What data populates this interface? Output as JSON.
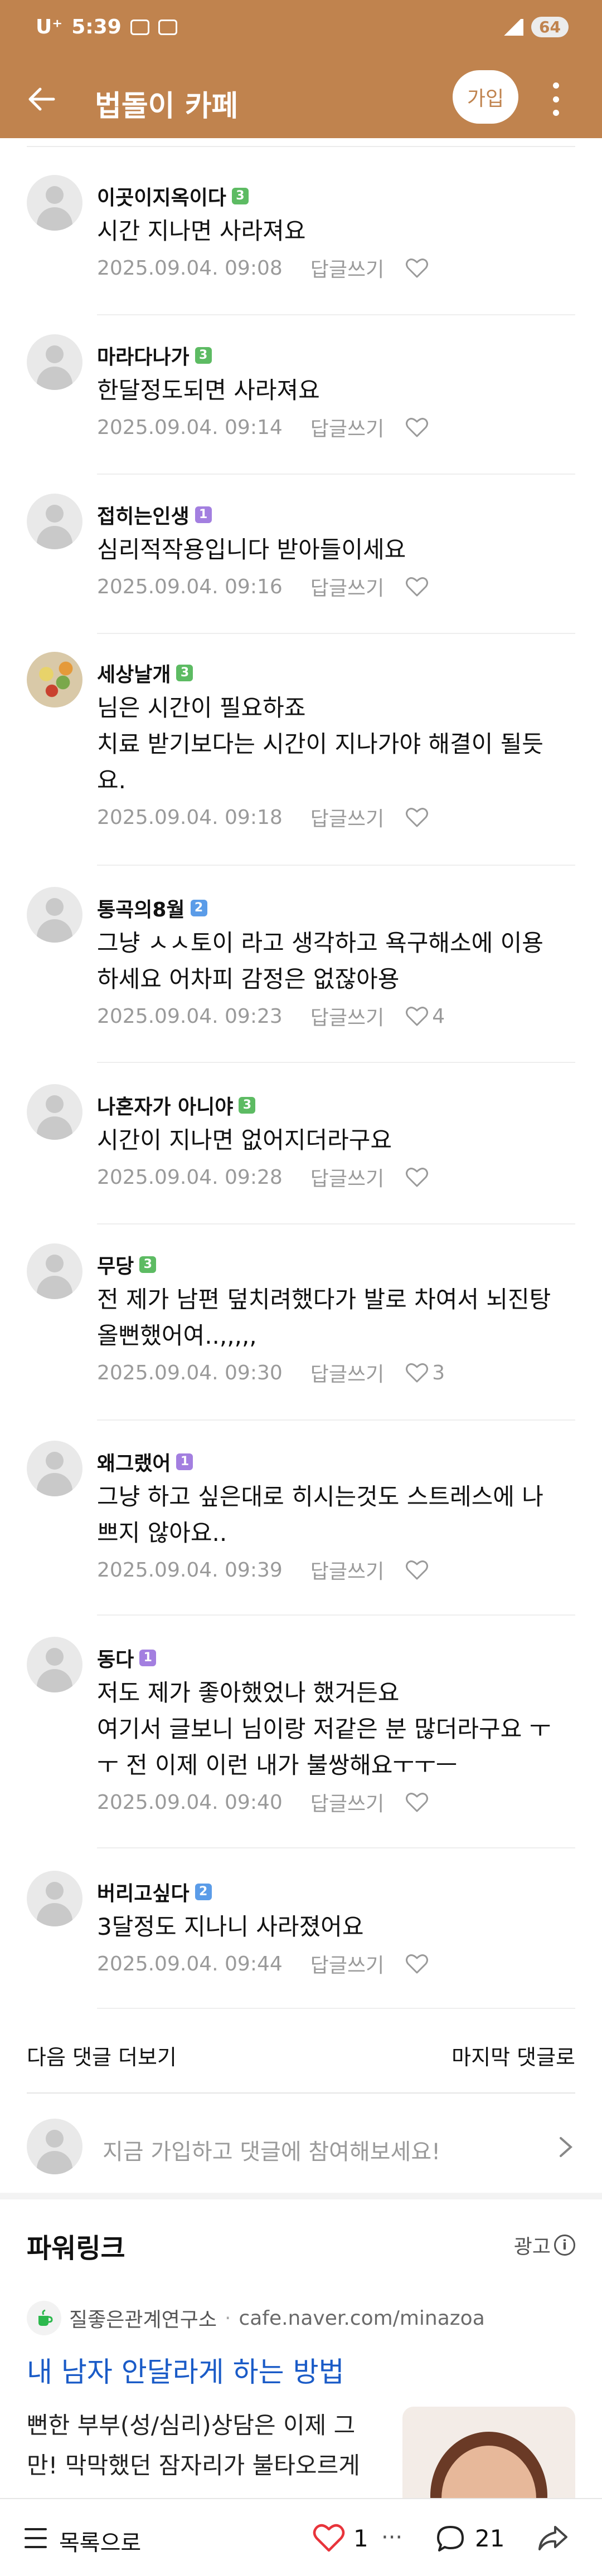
{
  "status_bar": {
    "carrier": "U⁺",
    "time": "5:39",
    "battery": "64"
  },
  "header": {
    "title": "법돌이 카페",
    "join_label": "가입"
  },
  "comments": [
    {
      "author": "이곳이지옥이다",
      "level": "3",
      "lines": [
        "시간 지나면 사라져요"
      ],
      "date": "2025.09.04. 09:08",
      "reply": "답글쓰기",
      "likes": ""
    },
    {
      "author": "마라다나가",
      "level": "3",
      "lines": [
        "한달정도되면 사라져요"
      ],
      "date": "2025.09.04. 09:14",
      "reply": "답글쓰기",
      "likes": ""
    },
    {
      "author": "접히는인생",
      "level": "1",
      "lines": [
        "심리적작용입니다 받아들이세요"
      ],
      "date": "2025.09.04. 09:16",
      "reply": "답글쓰기",
      "likes": ""
    },
    {
      "author": "세상날개",
      "level": "3",
      "lines": [
        "님은 시간이 필요하죠",
        "치료 받기보다는 시간이 지나가야 해결이 될듯",
        "요."
      ],
      "date": "2025.09.04. 09:18",
      "reply": "답글쓰기",
      "likes": ""
    },
    {
      "author": "통곡의8월",
      "level": "2",
      "lines": [
        "그냥 ㅅㅅ토이 라고 생각하고 욕구해소에 이용",
        "하세요 어차피 감정은 없잖아용"
      ],
      "date": "2025.09.04. 09:23",
      "reply": "답글쓰기",
      "likes": "4"
    },
    {
      "author": "나혼자가 아니야",
      "level": "3",
      "lines": [
        "시간이 지나면 없어지더라구요"
      ],
      "date": "2025.09.04. 09:28",
      "reply": "답글쓰기",
      "likes": ""
    },
    {
      "author": "무당",
      "level": "3",
      "lines": [
        "전 제가 남편 덮치려했다가 발로 차여서 뇌진탕",
        "올뻔했어여..,,,,,"
      ],
      "date": "2025.09.04. 09:30",
      "reply": "답글쓰기",
      "likes": "3"
    },
    {
      "author": "왜그랬어",
      "level": "1",
      "lines": [
        "그냥 하고 싶은대로 히시는것도 스트레스에 나",
        "쁘지 않아요.."
      ],
      "date": "2025.09.04. 09:39",
      "reply": "답글쓰기",
      "likes": ""
    },
    {
      "author": "동다",
      "level": "1",
      "lines": [
        "저도 제가 좋아했었나 했거든요",
        "여기서 글보니 님이랑 저같은 분 많더라구요 ㅜ",
        "ㅜ 전 이제 이런 내가 불쌍해요ㅜㅜㅡ"
      ],
      "date": "2025.09.04. 09:40",
      "reply": "답글쓰기",
      "likes": ""
    },
    {
      "author": "버리고싶다",
      "level": "2",
      "lines": [
        "3달정도 지나니 사라졌어요"
      ],
      "date": "2025.09.04. 09:44",
      "reply": "답글쓰기",
      "likes": ""
    }
  ],
  "nav": {
    "more_comments": "다음 댓글 더보기",
    "last_comments": "마지막 댓글로"
  },
  "join_prompt": {
    "text": "지금 가입하고 댓글에 참여해보세요!"
  },
  "power_link": {
    "title": "파워링크",
    "ad_label": "광고",
    "source_name": "질좋은관계연구소",
    "source_url": "cafe.naver.com/minazoa",
    "headline": "내 남자 안달라게 하는 방법",
    "body_lines": [
      "뻔한 부부(성/심리)상담은 이제 그",
      "만! 막막했던 잠자리가 불타오르게"
    ]
  },
  "bottom_bar": {
    "list_label": "목록으로",
    "like_count": "1",
    "comment_count": "21"
  },
  "colors": {
    "header": "#c0834e",
    "level_green": "#5dbb63",
    "level_purple": "#a37fe0",
    "level_blue": "#5b9ce8",
    "link_blue": "#1a5bc7"
  }
}
